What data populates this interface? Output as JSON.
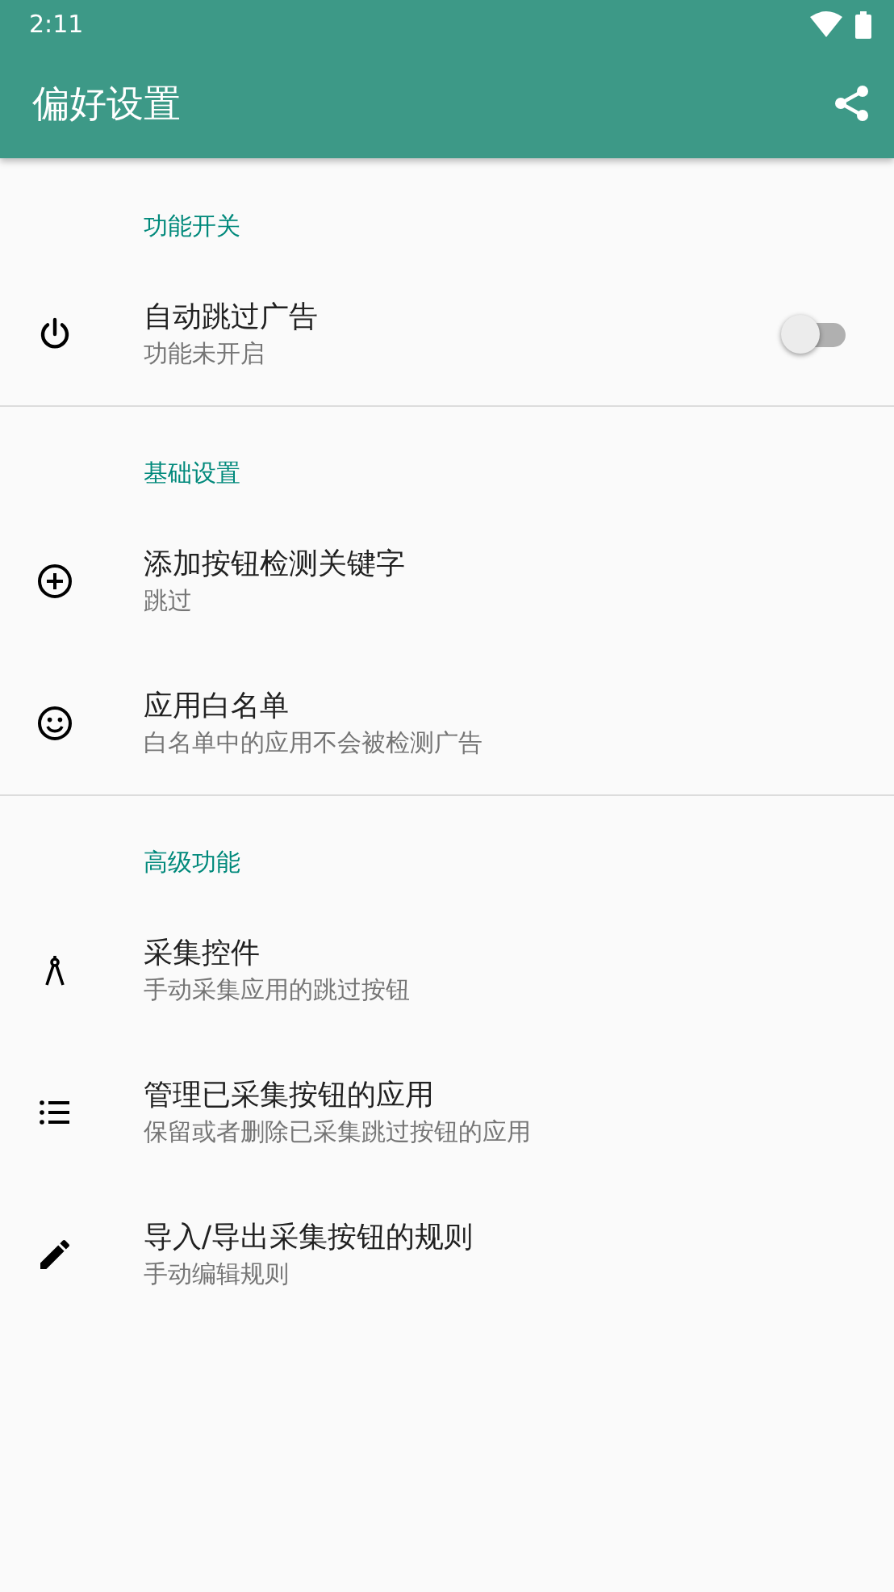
{
  "status_bar": {
    "time": "2:11"
  },
  "app_bar": {
    "title": "偏好设置"
  },
  "sections": [
    {
      "header": "功能开关",
      "items": [
        {
          "kind": "switch",
          "title": "自动跳过广告",
          "summary": "功能未开启",
          "on": false
        }
      ]
    },
    {
      "header": "基础设置",
      "items": [
        {
          "kind": "plain",
          "title": "添加按钮检测关键字",
          "summary": "跳过"
        },
        {
          "kind": "plain",
          "title": "应用白名单",
          "summary": "白名单中的应用不会被检测广告"
        }
      ]
    },
    {
      "header": "高级功能",
      "items": [
        {
          "kind": "plain",
          "title": "采集控件",
          "summary": "手动采集应用的跳过按钮"
        },
        {
          "kind": "plain",
          "title": "管理已采集按钮的应用",
          "summary": "保留或者删除已采集跳过按钮的应用"
        },
        {
          "kind": "plain",
          "title": "导入/导出采集按钮的规则",
          "summary": "手动编辑规则"
        }
      ]
    }
  ]
}
